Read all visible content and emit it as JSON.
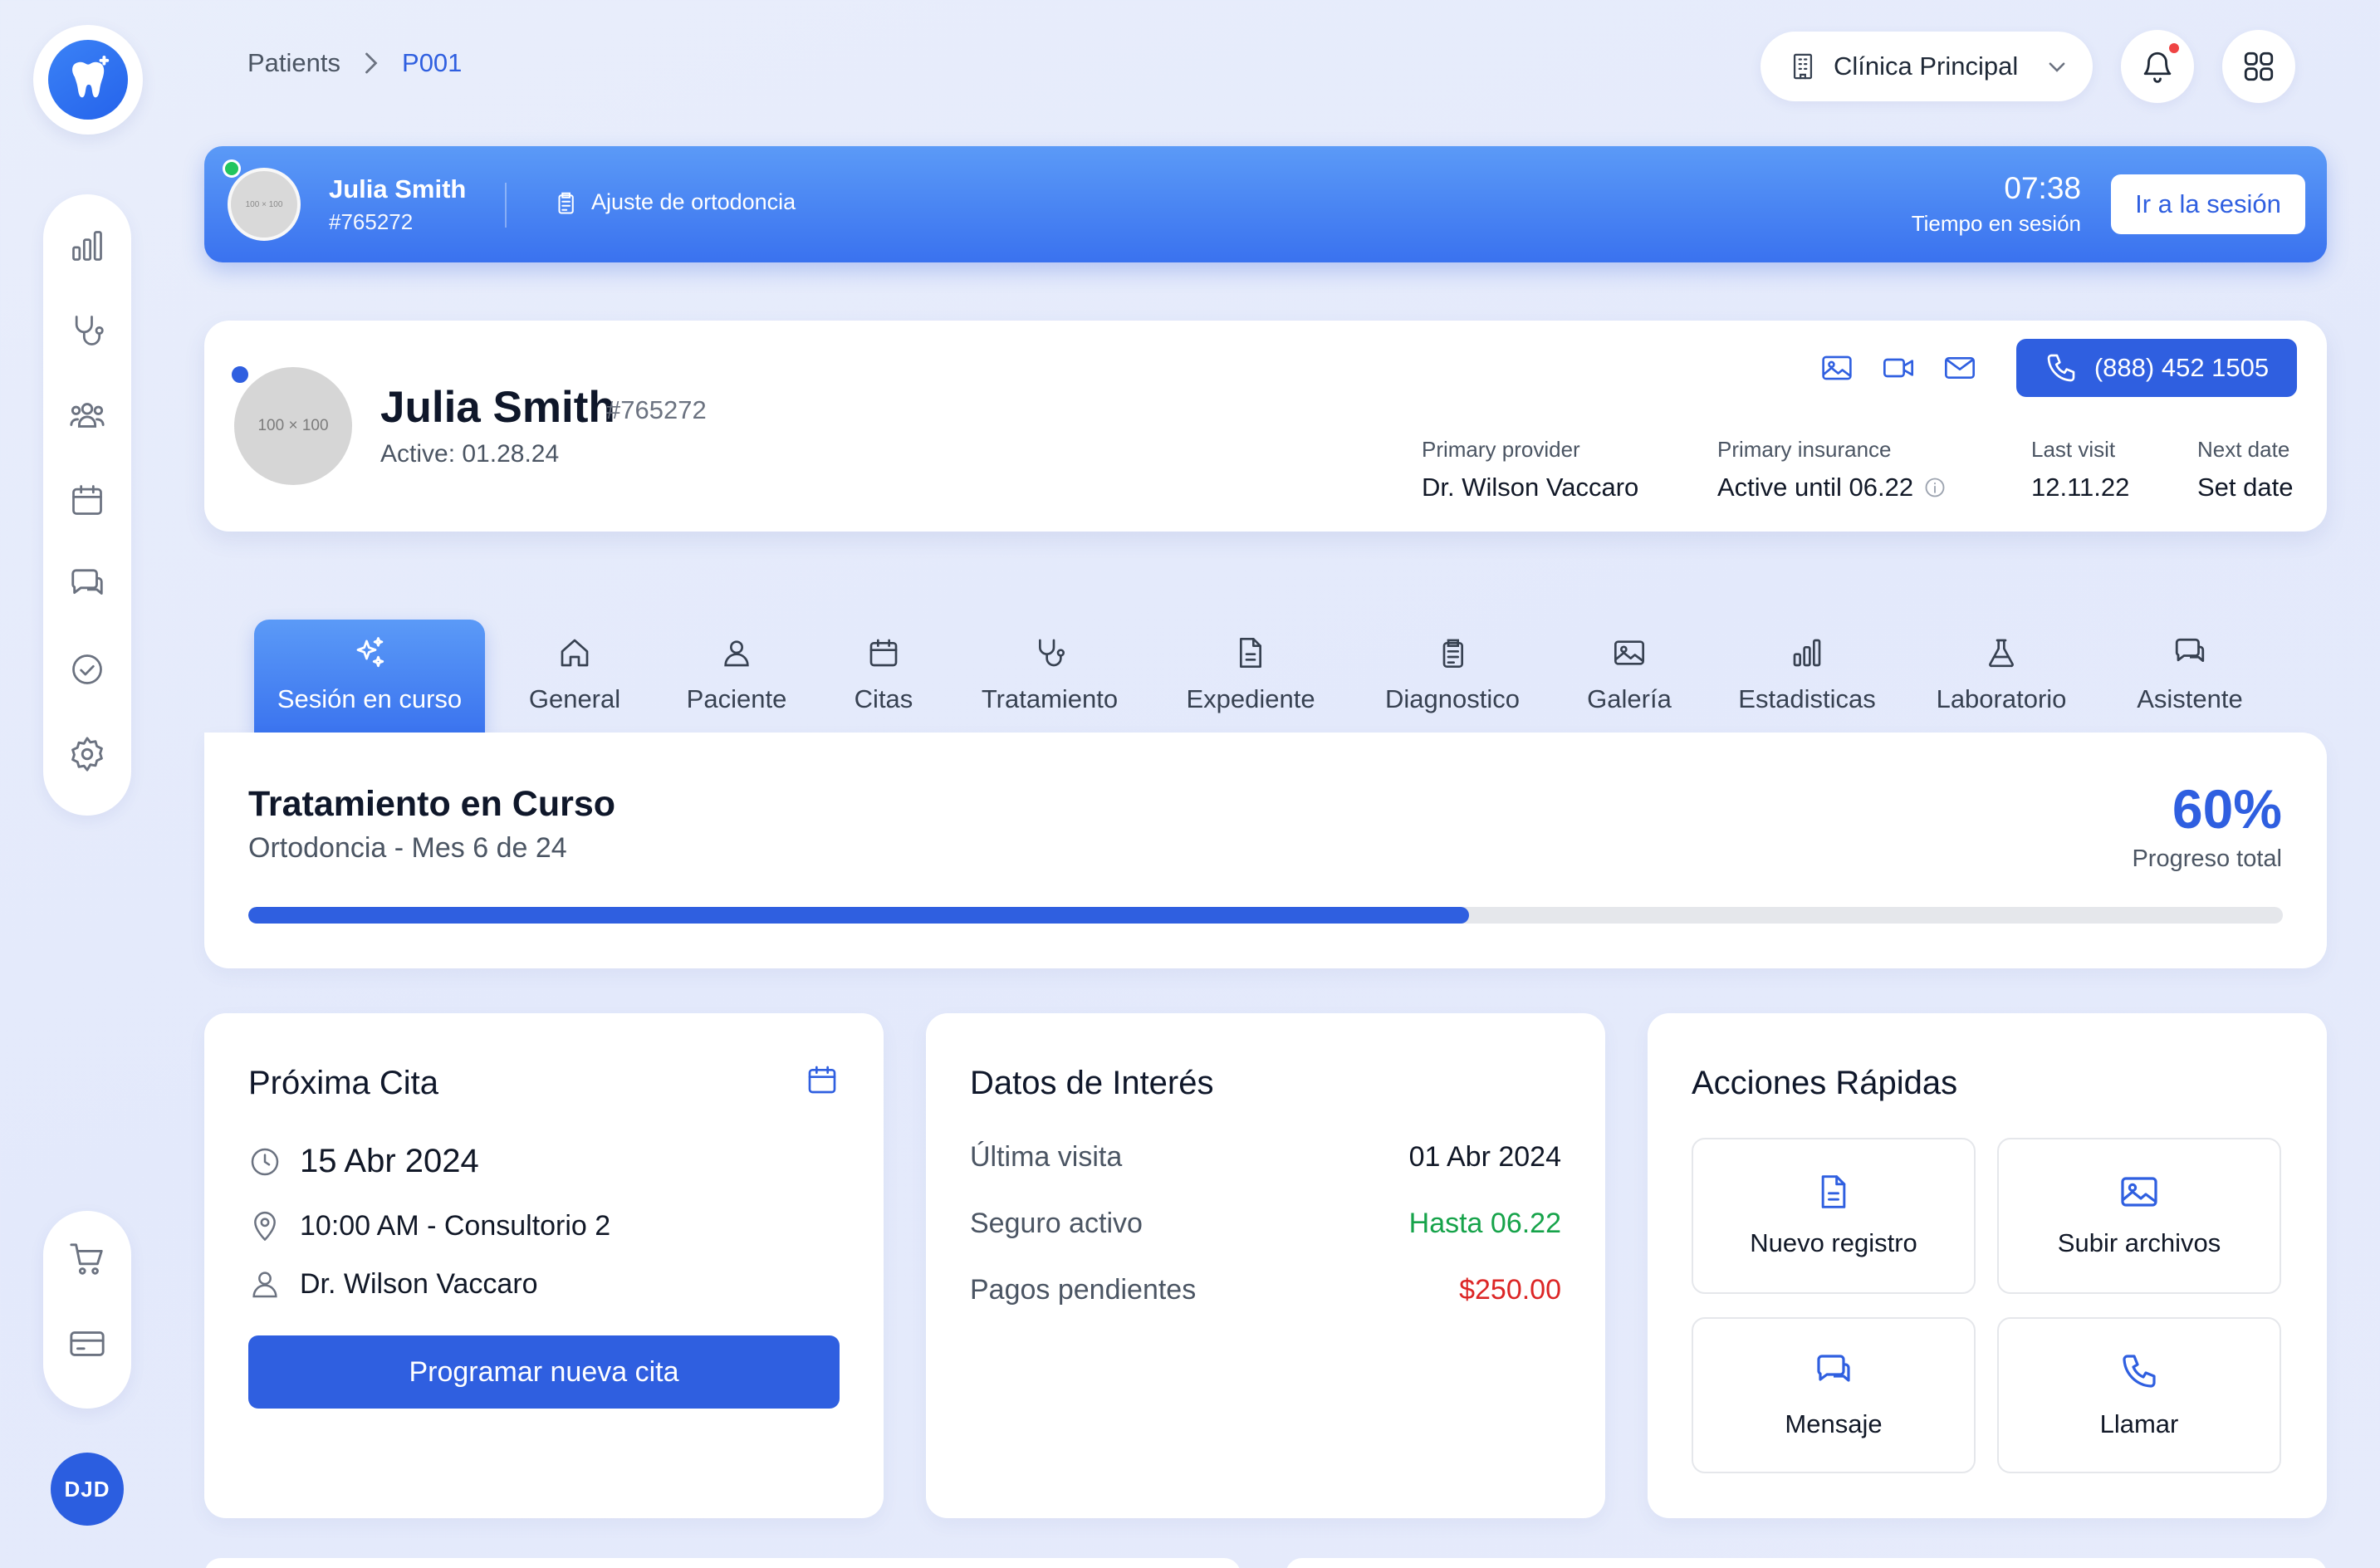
{
  "colors": {
    "primary": "#2f5fe0",
    "success": "#16a34a",
    "danger": "#dc2626",
    "online": "#22c55e",
    "notification": "#ef4444"
  },
  "brand": {
    "logo_icon": "tooth-sparkle-icon"
  },
  "nav": {
    "items": [
      "chart-icon",
      "stethoscope-icon",
      "users-icon",
      "calendar-icon",
      "chat-icon",
      "check-circle-icon",
      "settings-icon"
    ],
    "bottom_items": [
      "cart-icon",
      "credit-card-icon"
    ],
    "user_initials": "DJD"
  },
  "breadcrumb": {
    "parent": "Patients",
    "current": "P001"
  },
  "clinic": {
    "label": "Clínica Principal"
  },
  "session": {
    "patient_name": "Julia Smith",
    "patient_id": "#765272",
    "avatar_placeholder": "100 × 100",
    "procedure": "Ajuste de ortodoncia",
    "time": "07:38",
    "time_label": "Tiempo en sesión",
    "button": "Ir a la sesión"
  },
  "patient": {
    "name": "Julia Smith",
    "id": "#765272",
    "active": "Active: 01.28.24",
    "avatar_placeholder": "100 × 100",
    "phone": "(888) 452 1505",
    "meta": [
      {
        "label": "Primary provider",
        "value": "Dr. Wilson Vaccaro"
      },
      {
        "label": "Primary insurance",
        "value": "Active until 06.22"
      },
      {
        "label": "Last visit",
        "value": "12.11.22"
      },
      {
        "label": "Next date",
        "value": "Set date"
      }
    ]
  },
  "tabs": [
    {
      "label": "Sesión en curso",
      "icon": "sparkles-icon",
      "active": true
    },
    {
      "label": "General",
      "icon": "home-icon"
    },
    {
      "label": "Paciente",
      "icon": "user-icon"
    },
    {
      "label": "Citas",
      "icon": "calendar-icon"
    },
    {
      "label": "Tratamiento",
      "icon": "stethoscope-icon"
    },
    {
      "label": "Expediente",
      "icon": "document-icon"
    },
    {
      "label": "Diagnostico",
      "icon": "clipboard-icon"
    },
    {
      "label": "Galería",
      "icon": "image-icon"
    },
    {
      "label": "Estadisticas",
      "icon": "chart-icon"
    },
    {
      "label": "Laboratorio",
      "icon": "flask-icon"
    },
    {
      "label": "Asistente",
      "icon": "chat-icon"
    }
  ],
  "treatment": {
    "title": "Tratamiento en Curso",
    "subtitle": "Ortodoncia - Mes 6 de 24",
    "progress_text": "60%",
    "progress_value": 0.6,
    "progress_label": "Progreso total"
  },
  "appointment": {
    "title": "Próxima Cita",
    "date": "15 Abr 2024",
    "time_place": "10:00 AM - Consultorio 2",
    "doctor": "Dr. Wilson Vaccaro",
    "button": "Programar nueva cita"
  },
  "interest": {
    "title": "Datos de Interés",
    "rows": [
      {
        "label": "Última visita",
        "value": "01 Abr 2024"
      },
      {
        "label": "Seguro activo",
        "value": "Hasta 06.22"
      },
      {
        "label": "Pagos pendientes",
        "value": "$250.00"
      }
    ]
  },
  "quick_actions": {
    "title": "Acciones Rápidas",
    "items": [
      {
        "label": "Nuevo registro",
        "icon": "document-icon"
      },
      {
        "label": "Subir archivos",
        "icon": "image-icon"
      },
      {
        "label": "Mensaje",
        "icon": "chat-icon"
      },
      {
        "label": "Llamar",
        "icon": "phone-icon"
      }
    ]
  }
}
